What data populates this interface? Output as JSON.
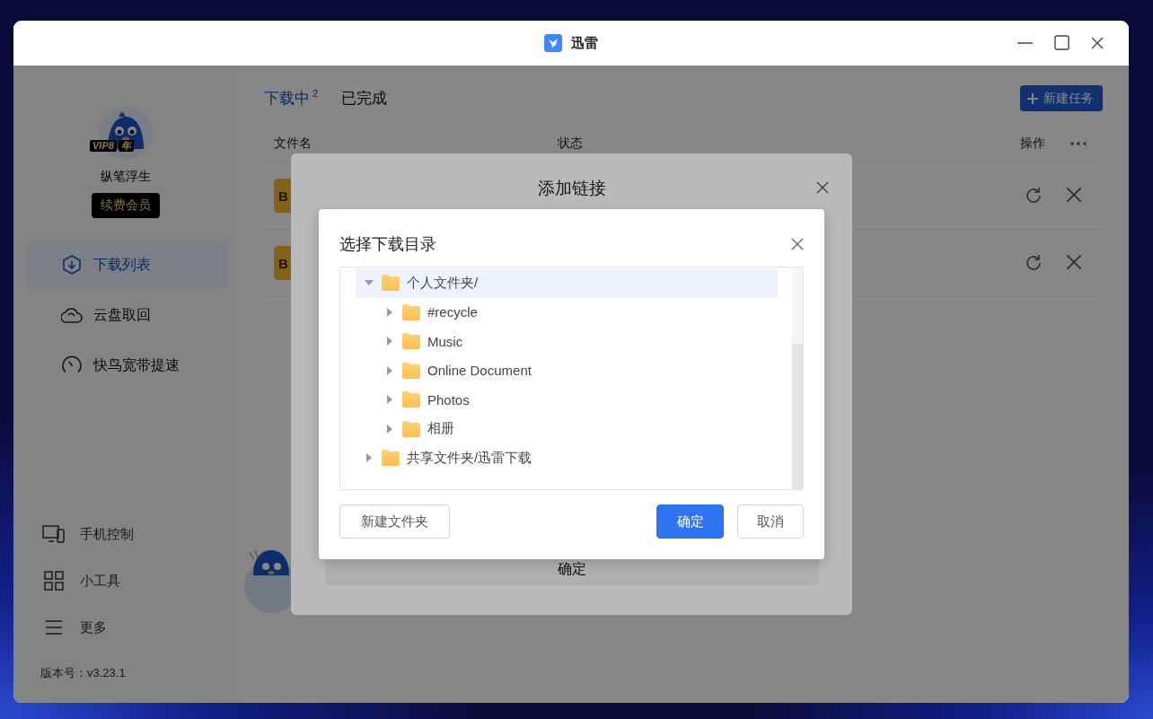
{
  "window": {
    "title": "迅雷"
  },
  "sidebar": {
    "user": {
      "vip_label": "VIP8",
      "vip_suffix": "年",
      "name": "纵笔浮生",
      "renew_button": "续费会员"
    },
    "nav": [
      {
        "label": "下载列表",
        "selected": true
      },
      {
        "label": "云盘取回",
        "selected": false
      },
      {
        "label": "快鸟宽带提速",
        "selected": false
      }
    ],
    "bottom_nav": [
      {
        "label": "手机控制"
      },
      {
        "label": "小工具"
      },
      {
        "label": "更多"
      }
    ],
    "version": "版本号：v3.23.1"
  },
  "main": {
    "tabs": [
      {
        "label": "下载中",
        "count": "2",
        "selected": true
      },
      {
        "label": "已完成",
        "selected": false
      }
    ],
    "new_task_button": "新建任务",
    "columns": [
      "文件名",
      "状态",
      "操作"
    ],
    "rows": [
      {
        "file_badge": "B"
      },
      {
        "file_badge": "B"
      }
    ]
  },
  "add_link_dialog": {
    "title": "添加链接",
    "confirm_button": "确定"
  },
  "folder_dialog": {
    "title": "选择下载目录",
    "tree": [
      {
        "label": "个人文件夹/",
        "expanded": true,
        "selected": true,
        "children": [
          {
            "label": "#recycle",
            "expanded": false,
            "selected": false
          },
          {
            "label": "Music",
            "expanded": false,
            "selected": false
          },
          {
            "label": "Online Document",
            "expanded": false,
            "selected": false
          },
          {
            "label": "Photos",
            "expanded": false,
            "selected": false
          },
          {
            "label": "相册",
            "expanded": false,
            "selected": false
          }
        ]
      },
      {
        "label": "共享文件夹/迅雷下载",
        "expanded": false,
        "selected": false
      }
    ],
    "new_folder_button": "新建文件夹",
    "confirm_button": "确定",
    "cancel_button": "取消"
  }
}
